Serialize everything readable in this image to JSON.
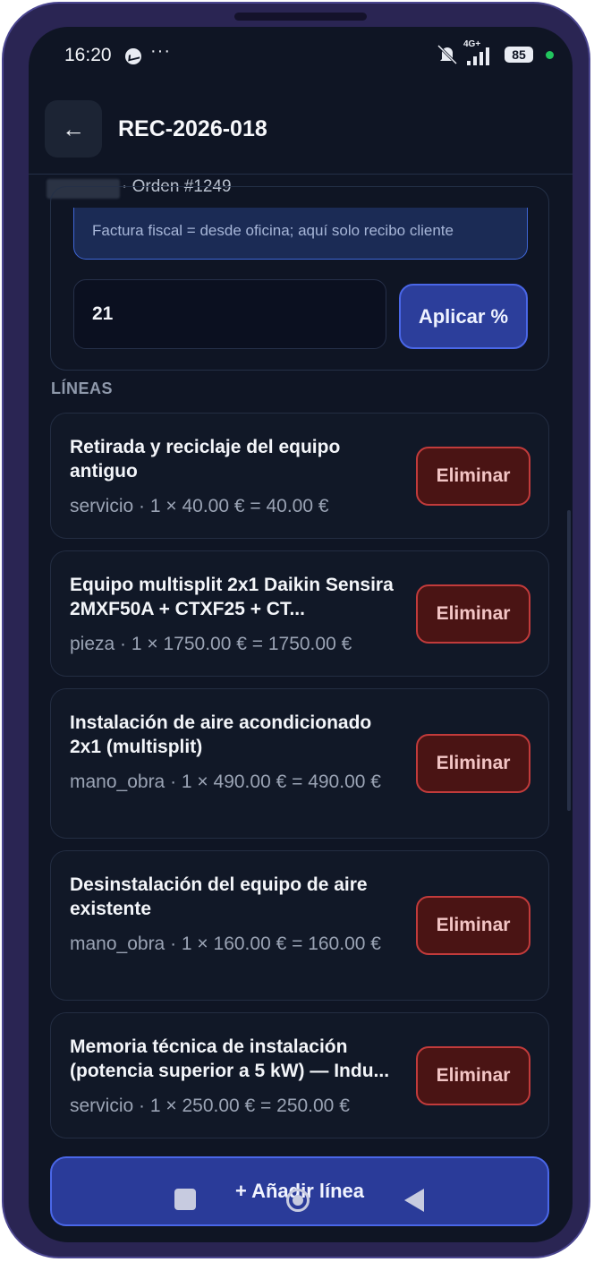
{
  "status_bar": {
    "time": "16:20",
    "more": "···",
    "network": "4G+",
    "battery": "85",
    "icons": [
      "messenger-icon",
      "mute-icon",
      "signal-icon",
      "battery-icon"
    ]
  },
  "header": {
    "back": "←",
    "title": "REC-2026-018"
  },
  "subheader": {
    "order": "· Orden #1249"
  },
  "config": {
    "note": "Factura fiscal = desde oficina; aquí solo recibo cliente",
    "percent_value": "21",
    "apply_label": "Aplicar %"
  },
  "lines_section": {
    "label": "LÍNEAS",
    "delete_label": "Eliminar",
    "items": [
      {
        "title": "Retirada y reciclaje del equipo antiguo",
        "meta": "servicio · 1 × 40.00 € = 40.00 €"
      },
      {
        "title": "Equipo multisplit 2x1 Daikin Sensira 2MXF50A + CTXF25 + CT...",
        "meta": "pieza · 1 × 1750.00 € = 1750.00 €"
      },
      {
        "title": "Instalación de aire acondicionado 2x1 (multisplit)",
        "meta": "mano_obra · 1 × 490.00 € = 490.00 €"
      },
      {
        "title": "Desinstalación del equipo de aire existente",
        "meta": "mano_obra · 1 × 160.00 € = 160.00 €"
      },
      {
        "title": "Memoria técnica de instalación (potencia superior a 5 kW) — Indu...",
        "meta": "servicio · 1 × 250.00 € = 250.00 €"
      }
    ]
  },
  "footer": {
    "add_label": "+ Añadir línea"
  },
  "colors": {
    "background": "#0f1524",
    "accent": "#2c3e9b",
    "danger": "#c23b3b"
  }
}
